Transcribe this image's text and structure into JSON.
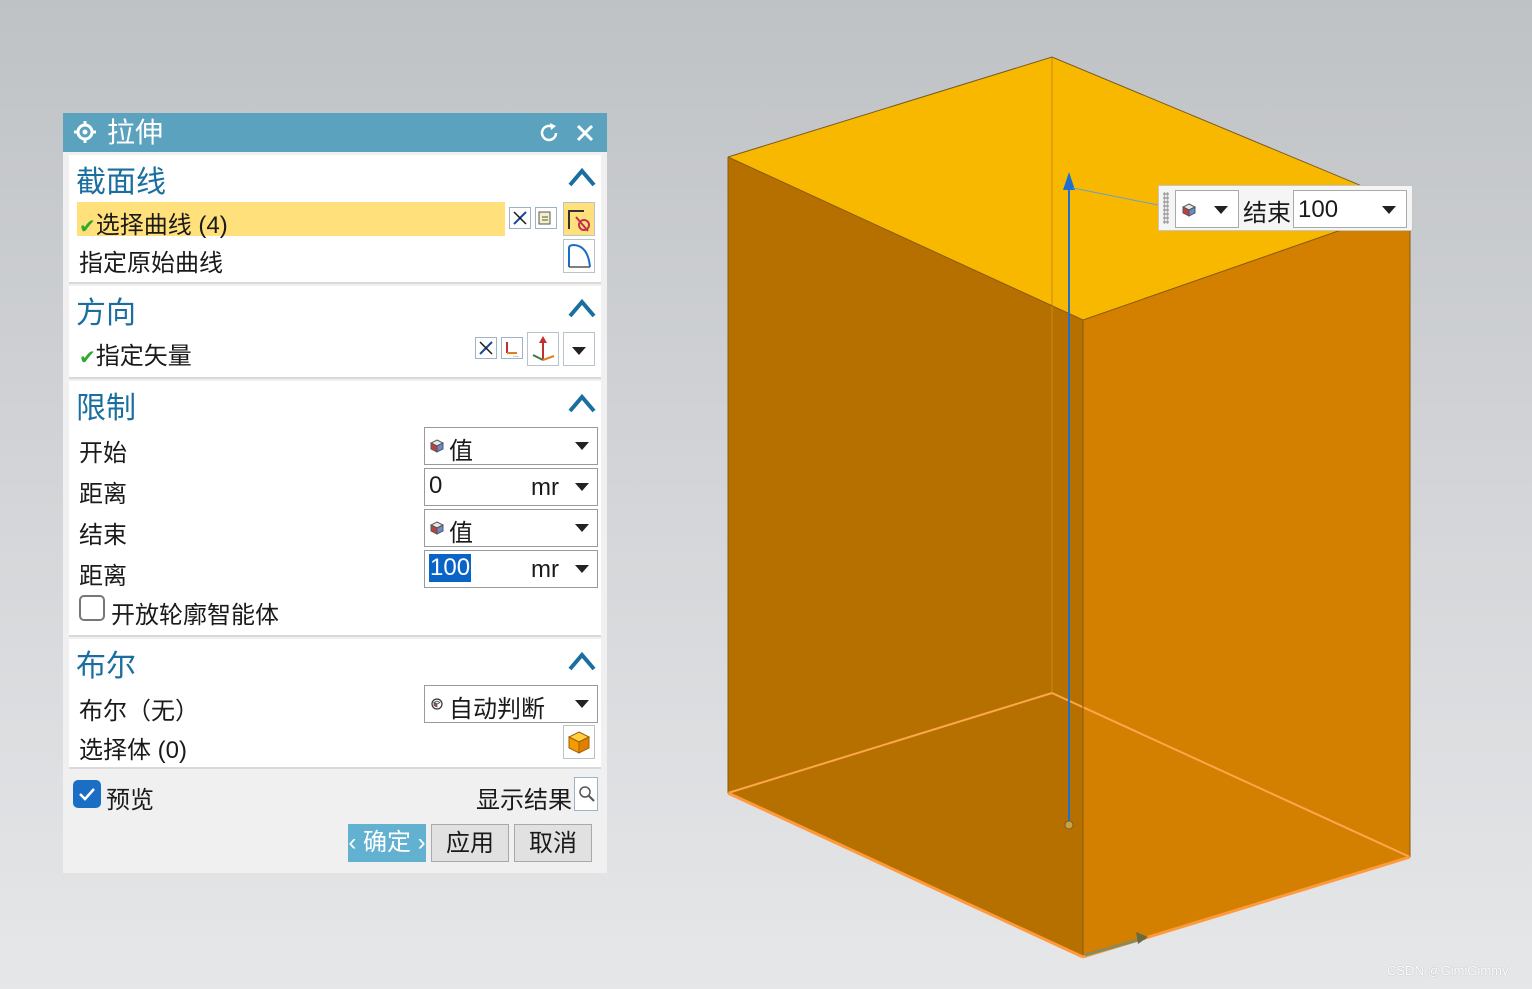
{
  "dialog": {
    "title": "拉伸",
    "section_curve": {
      "heading": "截面线",
      "select_curve": "选择曲线 (4)",
      "original_curve": "指定原始曲线"
    },
    "section_direction": {
      "heading": "方向",
      "vector": "指定矢量"
    },
    "section_limits": {
      "heading": "限制",
      "start_label": "开始",
      "start_option": "值",
      "start_distance_label": "距离",
      "start_distance": "0",
      "start_unit": "mr",
      "end_label": "结束",
      "end_option": "值",
      "end_distance_label": "距离",
      "end_distance": "100",
      "end_unit": "mr",
      "open_profile": "开放轮廓智能体"
    },
    "section_boolean": {
      "heading": "布尔",
      "boolean_label": "布尔（无）",
      "boolean_option": "自动判断",
      "select_body": "选择体 (0)"
    },
    "preview": {
      "label": "预览",
      "checked": true,
      "show_result": "显示结果"
    },
    "buttons": {
      "ok": "‹ 确定 ›",
      "apply": "应用",
      "cancel": "取消"
    }
  },
  "float_box": {
    "label": "结束",
    "value": "100"
  },
  "watermark": "CSDN @GimiGimmy",
  "colors": {
    "title_bar": "#5aa2bd",
    "section_heading": "#1a6fa0",
    "selection_highlight": "#ffe07a",
    "box_top": "#f8b800",
    "box_left": "#b67000",
    "box_right": "#d37f00",
    "vector": "#1f6fd0"
  },
  "icons": {
    "gear": "gear-icon",
    "reset": "reset-icon",
    "close": "close-icon",
    "collapse": "chevron-up-icon",
    "cube": "cube-icon",
    "search": "magnifier-icon"
  }
}
